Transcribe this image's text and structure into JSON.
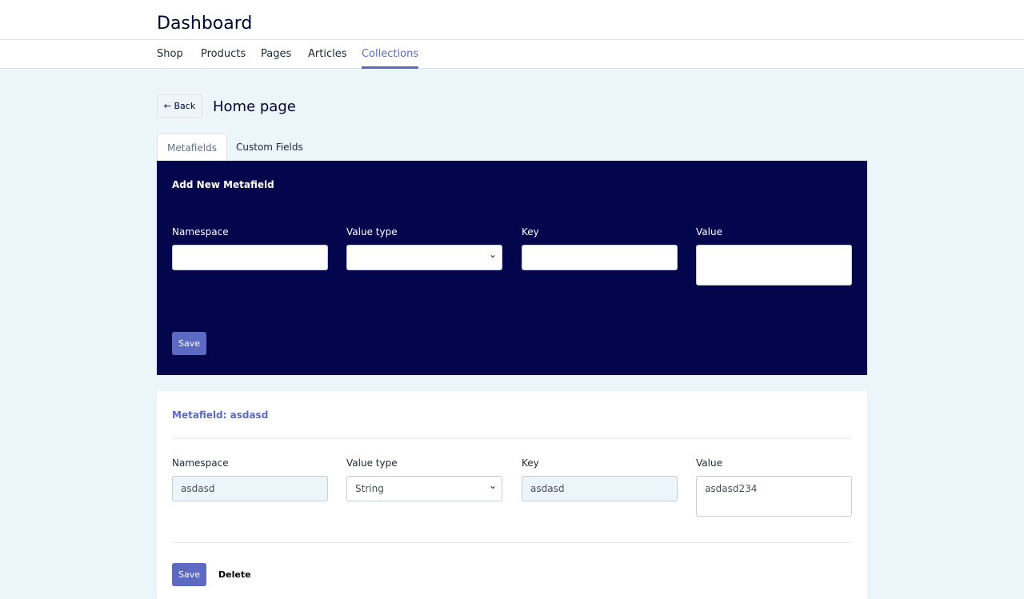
{
  "header": {
    "title": "Dashboard"
  },
  "nav": {
    "items": [
      {
        "label": "Shop"
      },
      {
        "label": "Products"
      },
      {
        "label": "Pages"
      },
      {
        "label": "Articles"
      },
      {
        "label": "Collections",
        "active": true
      }
    ]
  },
  "page": {
    "back_label": "← Back",
    "title": "Home page"
  },
  "tabs": [
    {
      "label": "Metafields",
      "active": true
    },
    {
      "label": "Custom Fields"
    }
  ],
  "new_metafield": {
    "title": "Add New Metafield",
    "labels": {
      "namespace": "Namespace",
      "value_type": "Value type",
      "key": "Key",
      "value": "Value"
    },
    "values": {
      "namespace": "",
      "value_type": "",
      "key": "",
      "value": ""
    },
    "save_label": "Save"
  },
  "metafield": {
    "title": "Metafield: asdasd",
    "labels": {
      "namespace": "Namespace",
      "value_type": "Value type",
      "key": "Key",
      "value": "Value"
    },
    "values": {
      "namespace": "asdasd",
      "value_type": "String",
      "key": "asdasd",
      "value": "asdasd234"
    },
    "save_label": "Save",
    "delete_label": "Delete"
  },
  "colors": {
    "accent": "#5c6ac4",
    "navy": "#03054d",
    "background": "#ebf5fa"
  }
}
